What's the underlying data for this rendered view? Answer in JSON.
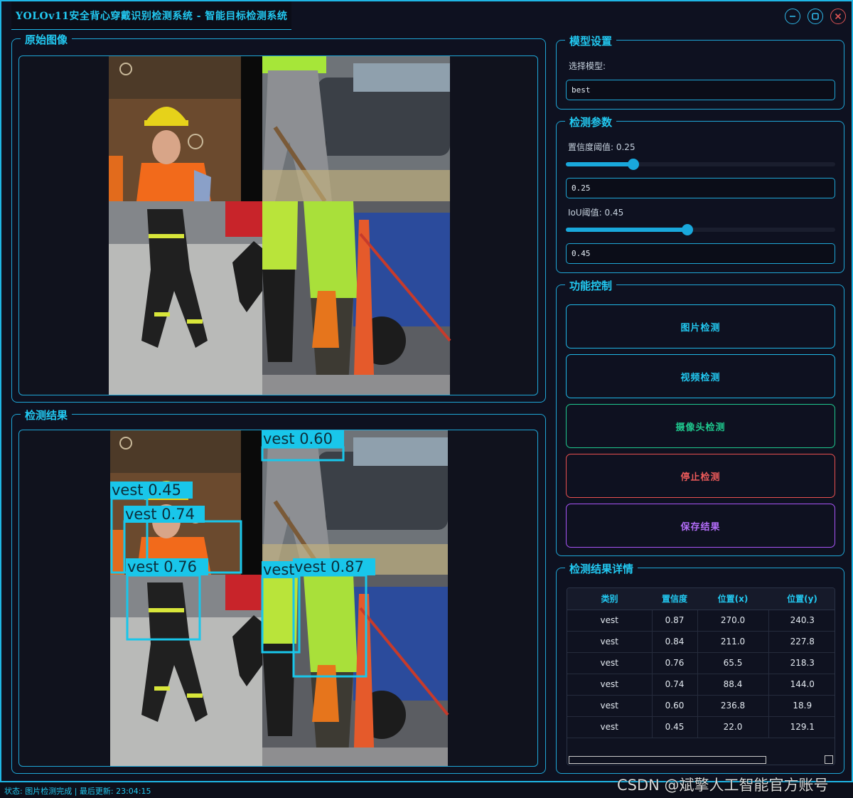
{
  "window": {
    "title": "YOLOv11安全背心穿戴识别检测系统 - 智能目标检测系统",
    "accent": "#1fb6e6"
  },
  "panels": {
    "original_title": "原始图像",
    "result_title": "检测结果"
  },
  "model_settings": {
    "title": "模型设置",
    "select_label": "选择模型:",
    "selected_model": "best"
  },
  "detection_params": {
    "title": "检测参数",
    "conf_label": "置信度阈值: 0.25",
    "conf_value": "0.25",
    "conf_level": 0.25,
    "iou_label": "IoU阈值: 0.45",
    "iou_value": "0.45",
    "iou_level": 0.45
  },
  "controls": {
    "title": "功能控制",
    "image_detect": "图片检测",
    "video_detect": "视频检测",
    "camera_detect": "摄像头检测",
    "stop_detect": "停止检测",
    "save_result": "保存结果",
    "colors": {
      "image_detect": "#1fb6e6",
      "video_detect": "#1fb6e6",
      "camera_detect": "#1fc88e",
      "stop_detect": "#e85050",
      "save_result": "#a855f7"
    }
  },
  "details": {
    "title": "检测结果详情",
    "columns": [
      "类别",
      "置信度",
      "位置(x)",
      "位置(y)"
    ],
    "rows": [
      [
        "vest",
        "0.87",
        "270.0",
        "240.3"
      ],
      [
        "vest",
        "0.84",
        "211.0",
        "227.8"
      ],
      [
        "vest",
        "0.76",
        "65.5",
        "218.3"
      ],
      [
        "vest",
        "0.74",
        "88.4",
        "144.0"
      ],
      [
        "vest",
        "0.60",
        "236.8",
        "18.9"
      ],
      [
        "vest",
        "0.45",
        "22.0",
        "129.1"
      ]
    ]
  },
  "detections": {
    "labels": [
      "vest 0.45",
      "vest 0.74",
      "vest 0.76",
      "vest 0.60",
      "vest",
      "vest 0.87"
    ],
    "box_color": "#19c6ea"
  },
  "status": {
    "text": "状态: 图片检测完成 | 最后更新: 23:04:15"
  },
  "watermark": "CSDN @斌擎人工智能官方账号"
}
